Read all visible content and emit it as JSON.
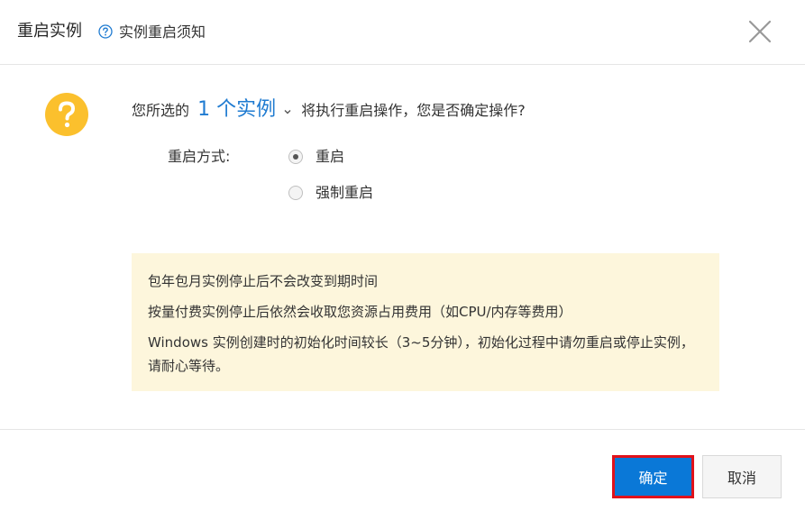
{
  "dialog": {
    "title": "重启实例",
    "help_link": "实例重启须知"
  },
  "prompt": {
    "prefix": "您所选的",
    "count": "1 个实例",
    "suffix": "将执行重启操作，您是否确定操作?"
  },
  "restart_method": {
    "label": "重启方式:",
    "options": [
      {
        "label": "重启",
        "selected": true
      },
      {
        "label": "强制重启",
        "selected": false
      }
    ]
  },
  "notice": {
    "lines": [
      "包年包月实例停止后不会改变到期时间",
      "按量付费实例停止后依然会收取您资源占用费用（如CPU/内存等费用）",
      "Windows 实例创建时的初始化时间较长（3~5分钟），初始化过程中请勿重启或停止实例，请耐心等待。"
    ]
  },
  "footer": {
    "confirm_label": "确定",
    "cancel_label": "取消"
  },
  "colors": {
    "primary": "#0a78d7",
    "highlight_border": "#e0121b",
    "warning_icon": "#fbc02d",
    "link": "#1f7bd1",
    "notice_bg": "#fdf6dc"
  },
  "icons": {
    "help": "question-circle-icon",
    "close": "close-icon",
    "warning": "question-mark-circle-icon",
    "dropdown": "chevron-down-icon"
  }
}
